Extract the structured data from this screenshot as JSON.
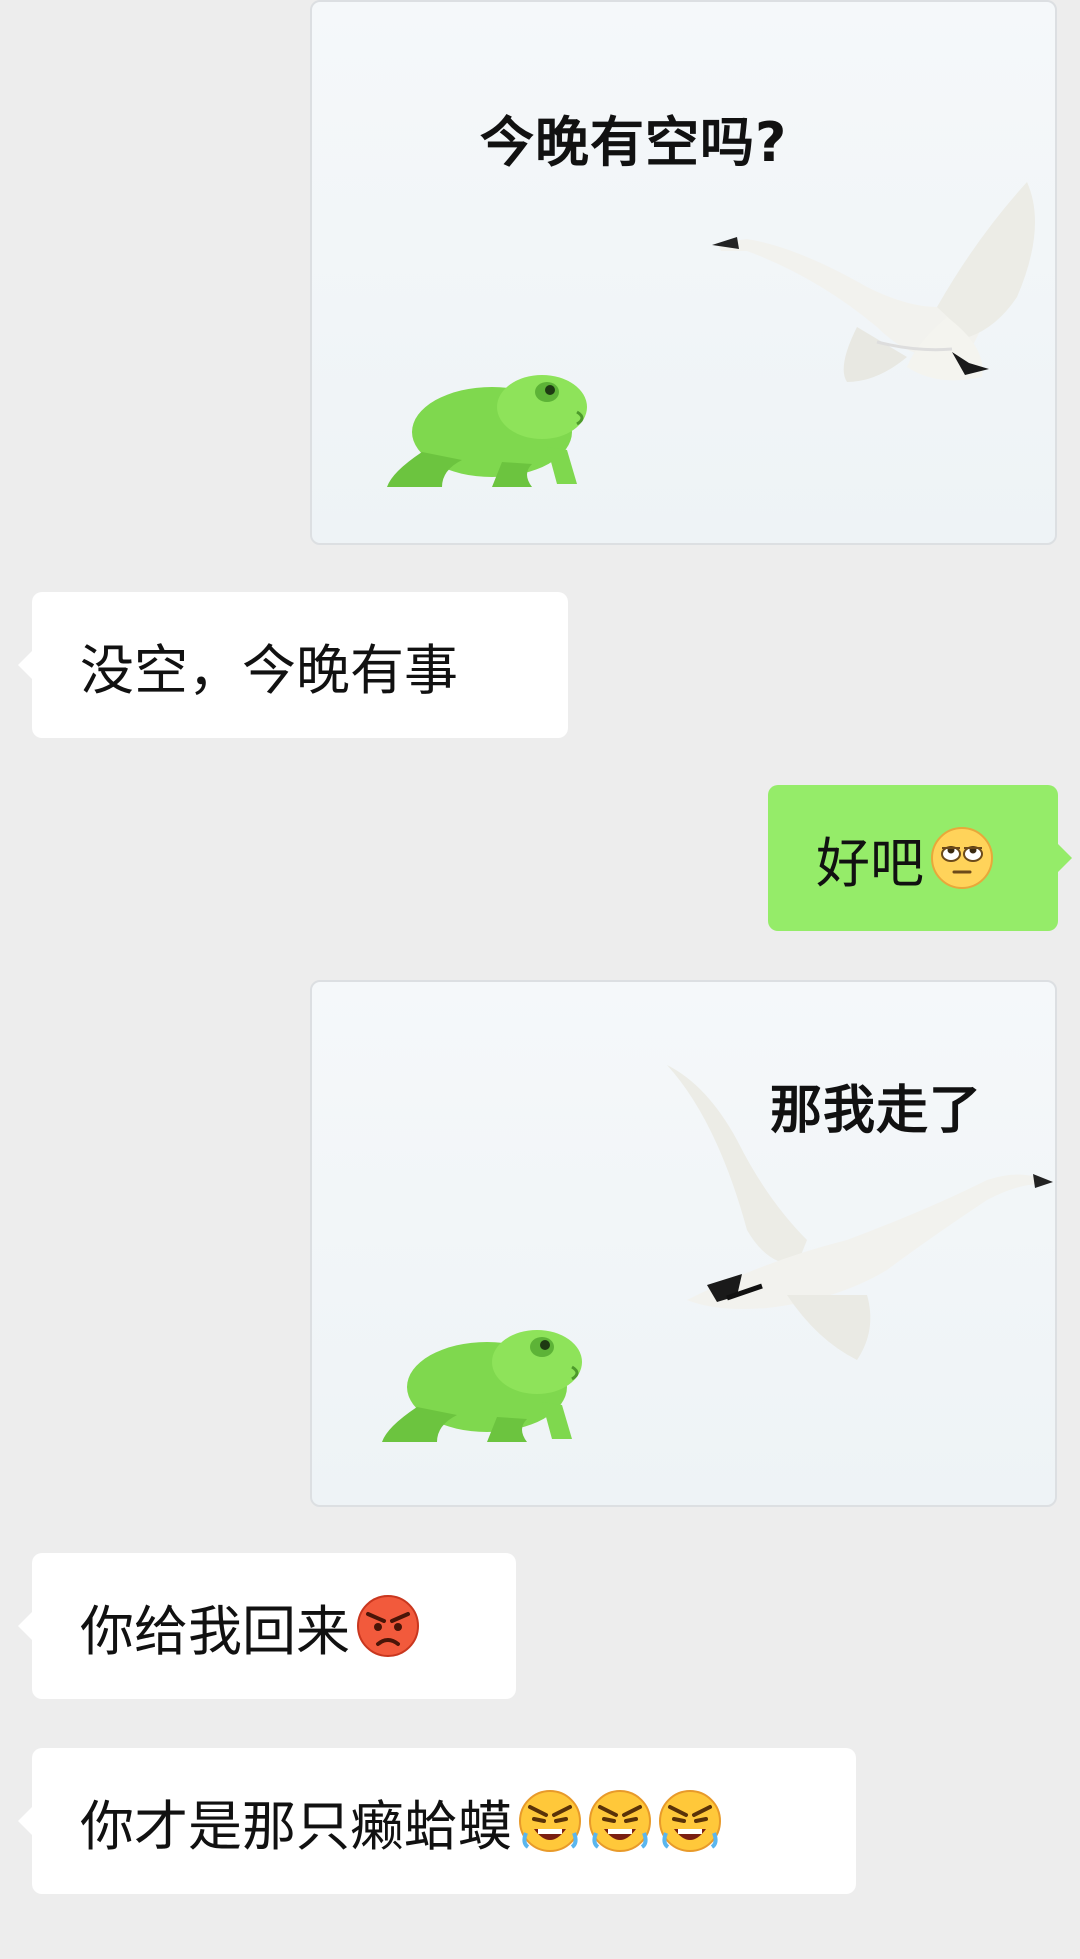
{
  "messages": [
    {
      "side": "right",
      "kind": "sticker",
      "caption": "今晚有空吗?"
    },
    {
      "side": "left",
      "kind": "text",
      "text": "没空，今晚有事"
    },
    {
      "side": "right",
      "kind": "text",
      "text": "好吧",
      "emoji": "eye-roll-face-emoji"
    },
    {
      "side": "right",
      "kind": "sticker",
      "caption": "那我走了"
    },
    {
      "side": "left",
      "kind": "text",
      "text": "你给我回来",
      "emoji": "angry-face-emoji"
    },
    {
      "side": "left",
      "kind": "text",
      "text": "你才是那只癞蛤蟆",
      "emoji": [
        "tantrum-face-emoji",
        "tantrum-face-emoji",
        "tantrum-face-emoji"
      ]
    }
  ],
  "colors": {
    "background": "#ededed",
    "received_bubble": "#ffffff",
    "sent_bubble": "#95ec69",
    "frog": "#7fd84e",
    "swan": "#f2f2ee"
  }
}
